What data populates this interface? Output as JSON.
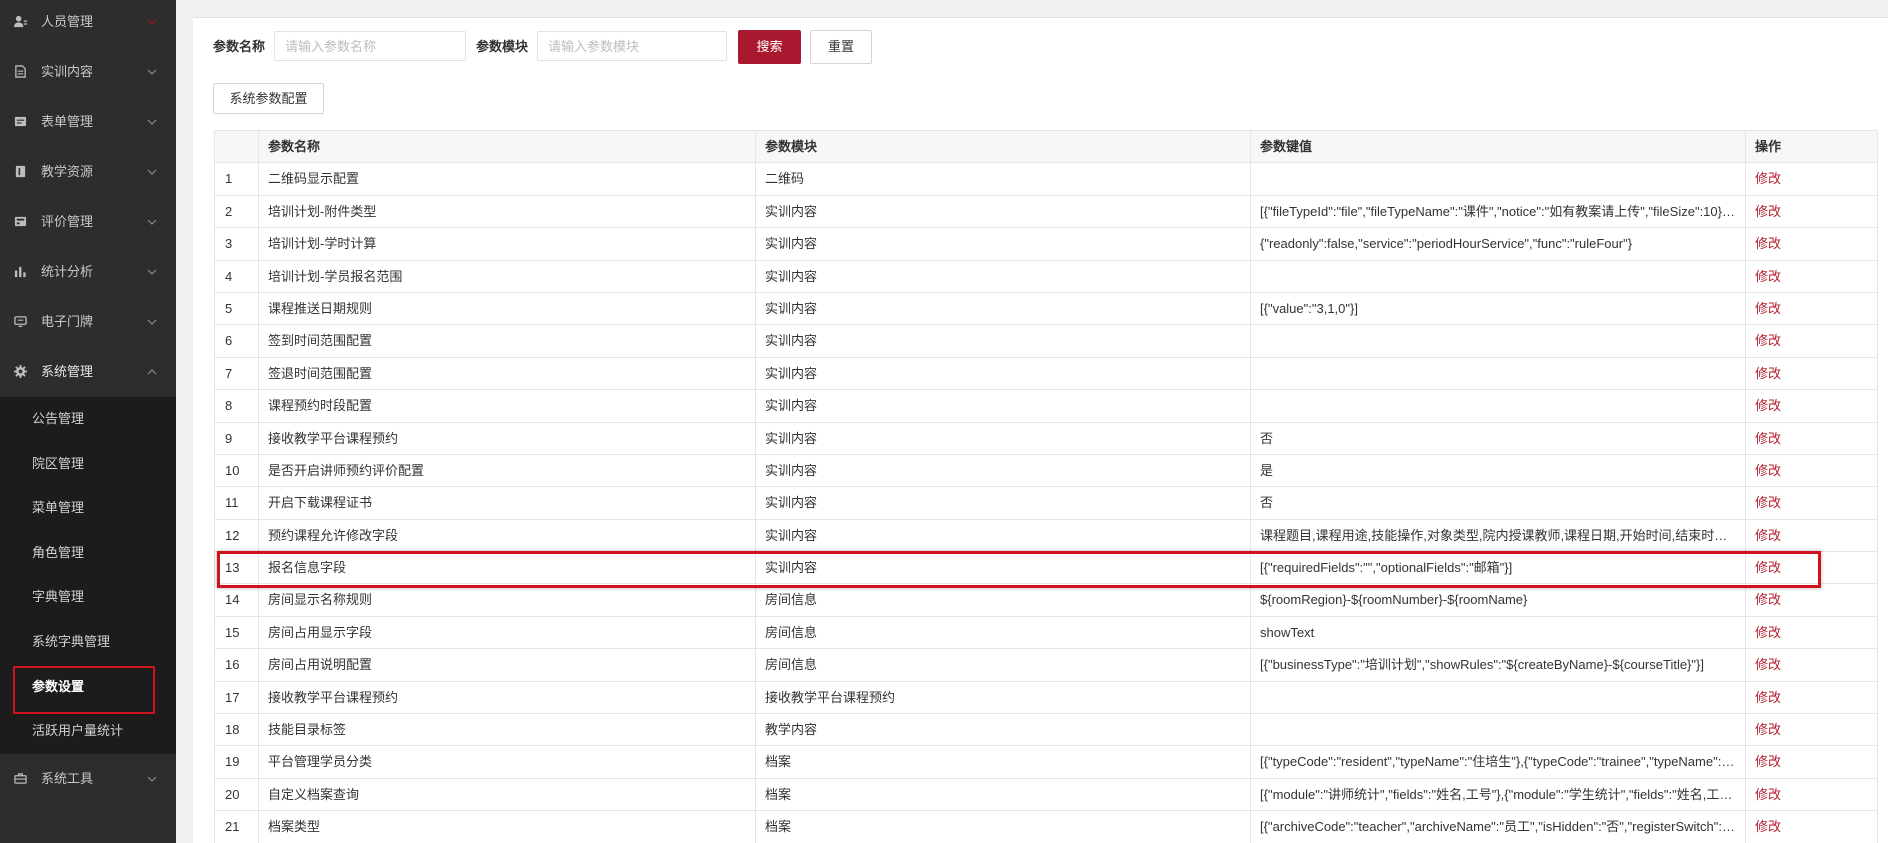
{
  "colors": {
    "accent": "#a8182e",
    "link": "#b5202e",
    "highlight": "#d0121e",
    "sidebar_bg": "#2d2d2d",
    "submenu_bg": "#1c1c1c"
  },
  "sidebar": {
    "menu": [
      {
        "label": "人员管理",
        "icon": "user-icon"
      },
      {
        "label": "实训内容",
        "icon": "list-icon"
      },
      {
        "label": "表单管理",
        "icon": "form-icon"
      },
      {
        "label": "教学资源",
        "icon": "book-icon"
      },
      {
        "label": "评价管理",
        "icon": "evaluation-icon"
      },
      {
        "label": "统计分析",
        "icon": "bar-chart-icon"
      },
      {
        "label": "电子门牌",
        "icon": "monitor-icon"
      },
      {
        "label": "系统管理",
        "icon": "gear-icon",
        "expanded": true
      }
    ],
    "submenu": [
      {
        "label": "公告管理"
      },
      {
        "label": "院区管理"
      },
      {
        "label": "菜单管理"
      },
      {
        "label": "角色管理"
      },
      {
        "label": "字典管理"
      },
      {
        "label": "系统字典管理"
      },
      {
        "label": "参数设置",
        "active": true,
        "highlighted": true
      },
      {
        "label": "活跃用户量统计"
      }
    ],
    "menu_after": [
      {
        "label": "系统工具",
        "icon": "toolbox-icon"
      }
    ]
  },
  "search": {
    "name_label": "参数名称",
    "name_placeholder": "请输入参数名称",
    "name_value": "",
    "module_label": "参数模块",
    "module_placeholder": "请输入参数模块",
    "module_value": "",
    "search_button": "搜索",
    "reset_button": "重置"
  },
  "toolbar": {
    "config_button": "系统参数配置"
  },
  "table": {
    "columns": [
      "",
      "参数名称",
      "参数模块",
      "参数键值",
      "操作"
    ],
    "rows": [
      {
        "index": "1",
        "name": "二维码显示配置",
        "module": "二维码",
        "value": "",
        "action": "修改"
      },
      {
        "index": "2",
        "name": "培训计划-附件类型",
        "module": "实训内容",
        "value": "[{\"fileTypeId\":\"file\",\"fileTypeName\":\"课件\",\"notice\":\"如有教案请上传\",\"fileSize\":10},{\"f...",
        "action": "修改"
      },
      {
        "index": "3",
        "name": "培训计划-学时计算",
        "module": "实训内容",
        "value": "{\"readonly\":false,\"service\":\"periodHourService\",\"func\":\"ruleFour\"}",
        "action": "修改"
      },
      {
        "index": "4",
        "name": "培训计划-学员报名范围",
        "module": "实训内容",
        "value": "",
        "action": "修改"
      },
      {
        "index": "5",
        "name": "课程推送日期规则",
        "module": "实训内容",
        "value": "[{\"value\":\"3,1,0\"}]",
        "action": "修改"
      },
      {
        "index": "6",
        "name": "签到时间范围配置",
        "module": "实训内容",
        "value": "",
        "action": "修改"
      },
      {
        "index": "7",
        "name": "签退时间范围配置",
        "module": "实训内容",
        "value": "",
        "action": "修改"
      },
      {
        "index": "8",
        "name": "课程预约时段配置",
        "module": "实训内容",
        "value": "",
        "action": "修改"
      },
      {
        "index": "9",
        "name": "接收教学平台课程预约",
        "module": "实训内容",
        "value": "否",
        "action": "修改"
      },
      {
        "index": "10",
        "name": "是否开启讲师预约评价配置",
        "module": "实训内容",
        "value": "是",
        "action": "修改"
      },
      {
        "index": "11",
        "name": "开启下载课程证书",
        "module": "实训内容",
        "value": "否",
        "action": "修改"
      },
      {
        "index": "12",
        "name": "预约课程允许修改字段",
        "module": "实训内容",
        "value": "课程题目,课程用途,技能操作,对象类型,院内授课教师,课程日期,开始时间,结束时间,...",
        "action": "修改"
      },
      {
        "index": "13",
        "name": "报名信息字段",
        "module": "实训内容",
        "value": "[{\"requiredFields\":\"\",\"optionalFields\":\"邮箱\"}]",
        "action": "修改",
        "highlighted": true
      },
      {
        "index": "14",
        "name": "房间显示名称规则",
        "module": "房间信息",
        "value": "${roomRegion}-${roomNumber}-${roomName}",
        "action": "修改"
      },
      {
        "index": "15",
        "name": "房间占用显示字段",
        "module": "房间信息",
        "value": "showText",
        "action": "修改"
      },
      {
        "index": "16",
        "name": "房间占用说明配置",
        "module": "房间信息",
        "value": "[{\"businessType\":\"培训计划\",\"showRules\":\"${createByName}-${courseTitle}\"}]",
        "action": "修改"
      },
      {
        "index": "17",
        "name": "接收教学平台课程预约",
        "module": "接收教学平台课程预约",
        "value": "",
        "action": "修改"
      },
      {
        "index": "18",
        "name": "技能目录标签",
        "module": "教学内容",
        "value": "",
        "action": "修改"
      },
      {
        "index": "19",
        "name": "平台管理学员分类",
        "module": "档案",
        "value": "[{\"typeCode\":\"resident\",\"typeName\":\"住培生\"},{\"typeCode\":\"trainee\",\"typeName\":\"实...",
        "action": "修改"
      },
      {
        "index": "20",
        "name": "自定义档案查询",
        "module": "档案",
        "value": "[{\"module\":\"讲师统计\",\"fields\":\"姓名,工号\"},{\"module\":\"学生统计\",\"fields\":\"姓名,工号\"}]",
        "action": "修改"
      },
      {
        "index": "21",
        "name": "档案类型",
        "module": "档案",
        "value": "[{\"archiveCode\":\"teacher\",\"archiveName\":\"员工\",\"isHidden\":\"否\",\"registerSwitch\":\"关...",
        "action": "修改"
      }
    ]
  }
}
